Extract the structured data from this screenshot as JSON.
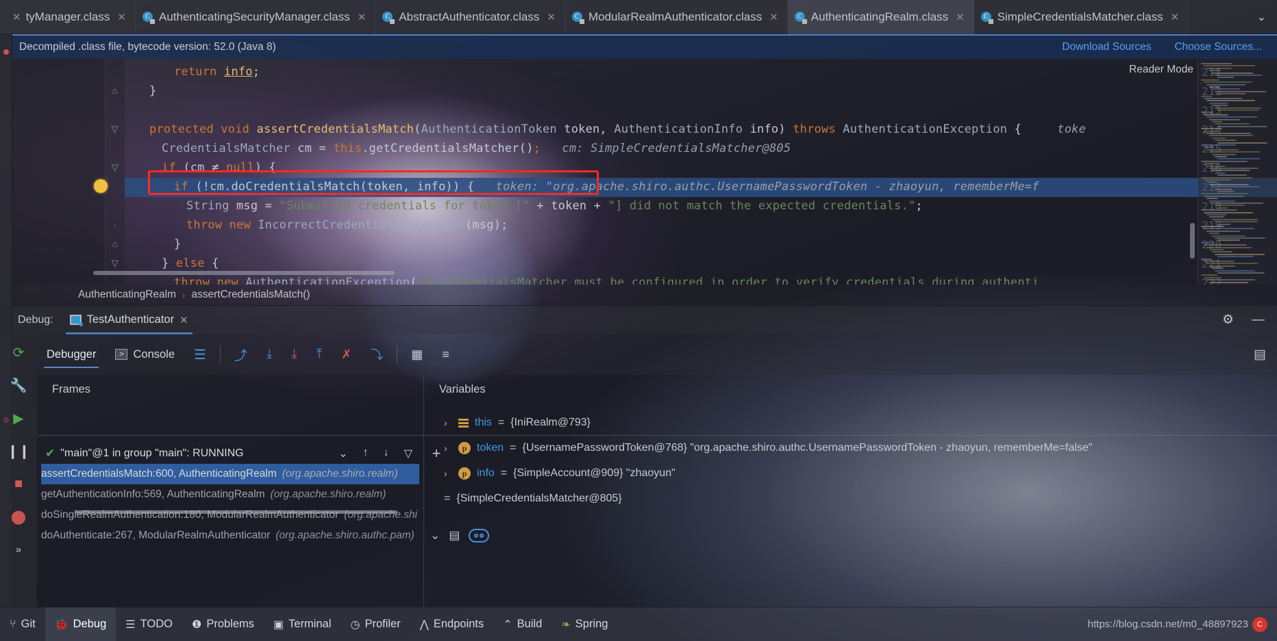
{
  "tabs": [
    {
      "label": "tyManager.class",
      "icon": "class-file-icon",
      "active": false,
      "truncated": true
    },
    {
      "label": "AuthenticatingSecurityManager.class",
      "icon": "class-file-icon",
      "active": false
    },
    {
      "label": "AbstractAuthenticator.class",
      "icon": "class-file-icon",
      "active": false
    },
    {
      "label": "ModularRealmAuthenticator.class",
      "icon": "class-file-icon",
      "active": false
    },
    {
      "label": "AuthenticatingRealm.class",
      "icon": "class-file-icon",
      "active": true
    },
    {
      "label": "SimpleCredentialsMatcher.class",
      "icon": "class-file-icon",
      "active": false
    }
  ],
  "tab_overflow_icon": "chevron-down-icon",
  "notification": {
    "message": "Decompiled .class file, bytecode version: 52.0 (Java 8)",
    "download_sources": "Download Sources",
    "choose_sources": "Choose Sources..."
  },
  "editor": {
    "reader_mode": "Reader Mode",
    "highlighted_line": 217,
    "lines": [
      {
        "num": 211,
        "indent": 4,
        "fold": "",
        "tokens": [
          {
            "t": "return ",
            "c": "kw"
          },
          {
            "t": "info",
            "c": "fld u"
          },
          {
            "t": ";",
            "c": "plain"
          }
        ]
      },
      {
        "num": 212,
        "indent": 2,
        "fold": "end",
        "tokens": [
          {
            "t": "}",
            "c": "plain"
          }
        ]
      },
      {
        "num": 213,
        "indent": 0,
        "fold": "",
        "tokens": []
      },
      {
        "num": 214,
        "indent": 2,
        "fold": "open",
        "tokens": [
          {
            "t": "protected ",
            "c": "kw"
          },
          {
            "t": "void ",
            "c": "kw"
          },
          {
            "t": "assertCredentialsMatch",
            "c": "kw2"
          },
          {
            "t": "(",
            "c": "plain"
          },
          {
            "t": "AuthenticationToken",
            "c": "typ"
          },
          {
            "t": " token, ",
            "c": "plain"
          },
          {
            "t": "AuthenticationInfo",
            "c": "typ"
          },
          {
            "t": " info) ",
            "c": "plain"
          },
          {
            "t": "throws ",
            "c": "kw"
          },
          {
            "t": "AuthenticationException",
            "c": "typ"
          },
          {
            "t": " {",
            "c": "plain"
          },
          {
            "t": "     toke",
            "c": "hint"
          }
        ]
      },
      {
        "num": 215,
        "indent": 3,
        "fold": "",
        "tokens": [
          {
            "t": "CredentialsMatcher",
            "c": "typ"
          },
          {
            "t": " cm = ",
            "c": "plain"
          },
          {
            "t": "this",
            "c": "kw"
          },
          {
            "t": ".getCredentialsMatcher",
            "c": "plain"
          },
          {
            "t": "()",
            "c": "plain"
          },
          {
            "t": ";",
            "c": "kw"
          },
          {
            "t": "   cm: SimpleCredentialsMatcher@805",
            "c": "hint"
          }
        ]
      },
      {
        "num": 216,
        "indent": 3,
        "fold": "open",
        "tokens": [
          {
            "t": "if ",
            "c": "kw"
          },
          {
            "t": "(cm ",
            "c": "plain"
          },
          {
            "t": "≠",
            "c": "plain"
          },
          {
            "t": " ",
            "c": "plain"
          },
          {
            "t": "null",
            "c": "kw"
          },
          {
            "t": ") {",
            "c": "plain"
          }
        ]
      },
      {
        "num": 217,
        "indent": 4,
        "fold": "",
        "highlight": true,
        "tokens": [
          {
            "t": "if ",
            "c": "kw"
          },
          {
            "t": "(!cm.doCredentialsMatch(token, info)) {",
            "c": "plain"
          },
          {
            "t": "   token: \"org.apache.shiro.authc.UsernamePasswordToken - zhaoyun, rememberMe=f",
            "c": "hint"
          }
        ]
      },
      {
        "num": 218,
        "indent": 5,
        "fold": "",
        "tokens": [
          {
            "t": "String",
            "c": "typ"
          },
          {
            "t": " msg = ",
            "c": "plain"
          },
          {
            "t": "\"Submitted credentials for token [\"",
            "c": "str"
          },
          {
            "t": " + token + ",
            "c": "plain"
          },
          {
            "t": "\"] did not match the expected credentials.\"",
            "c": "str"
          },
          {
            "t": ";",
            "c": "plain"
          }
        ]
      },
      {
        "num": 219,
        "indent": 5,
        "fold": "dot",
        "tokens": [
          {
            "t": "throw ",
            "c": "kw"
          },
          {
            "t": "new ",
            "c": "kw"
          },
          {
            "t": "IncorrectCredentialsException",
            "c": "typ"
          },
          {
            "t": "(msg);",
            "c": "plain"
          }
        ]
      },
      {
        "num": 220,
        "indent": 4,
        "fold": "end",
        "tokens": [
          {
            "t": "}",
            "c": "plain"
          }
        ]
      },
      {
        "num": 221,
        "indent": 3,
        "fold": "open",
        "tokens": [
          {
            "t": "} ",
            "c": "plain"
          },
          {
            "t": "else ",
            "c": "kw"
          },
          {
            "t": "{",
            "c": "plain"
          }
        ]
      },
      {
        "num": 222,
        "indent": 4,
        "fold": "",
        "tokens": [
          {
            "t": "throw ",
            "c": "kw"
          },
          {
            "t": "new ",
            "c": "kw"
          },
          {
            "t": "AuthenticationException",
            "c": "typ"
          },
          {
            "t": "(",
            "c": "plain"
          },
          {
            "t": "\"A CredentialsMatcher must be configured in order to verify credentials during authenti",
            "c": "str"
          }
        ]
      }
    ]
  },
  "breadcrumb": {
    "items": [
      "AuthenticatingRealm",
      "assertCredentialsMatch()"
    ],
    "separator": "›"
  },
  "debug_header": {
    "label": "Debug:",
    "session_tab": "TestAuthenticator",
    "session_close_icon": "close-icon",
    "settings_icon": "gear-icon",
    "minimize_icon": "minimize-icon"
  },
  "debug_toolbar": {
    "tabs": [
      {
        "label": "Debugger",
        "selected": true,
        "icon": ""
      },
      {
        "label": "Console",
        "selected": false,
        "icon": "console-icon"
      }
    ],
    "icons": [
      "layout-lines-icon",
      "step-over-icon",
      "step-into-icon",
      "force-step-into-icon",
      "step-out-icon",
      "drop-frame-icon",
      "run-to-cursor-icon",
      "evaluate-expression-icon",
      "settings-lines-icon"
    ],
    "right_icon": "restore-layout-icon"
  },
  "left_rail_icons": [
    "rerun-icon",
    "wrench-icon",
    "resume-icon",
    "pause-icon",
    "stop-icon",
    "mute-breakpoints-icon",
    "more-icon"
  ],
  "frames": {
    "title": "Frames",
    "thread": "\"main\"@1 in group \"main\": RUNNING",
    "thread_controls": [
      "chevron-down-icon",
      "arrow-up-icon",
      "arrow-down-icon",
      "filter-icon"
    ],
    "rows": [
      {
        "name": "assertCredentialsMatch:600, AuthenticatingRealm",
        "pkg": "(org.apache.shiro.realm)",
        "selected": true
      },
      {
        "name": "getAuthenticationInfo:569, AuthenticatingRealm",
        "pkg": "(org.apache.shiro.realm)",
        "selected": false
      },
      {
        "name": "doSingleRealmAuthentication:180, ModularRealmAuthenticator",
        "pkg": "(org.apache.shi",
        "selected": false
      },
      {
        "name": "doAuthenticate:267, ModularRealmAuthenticator",
        "pkg": "(org.apache.shiro.authc.pam)",
        "selected": false
      }
    ]
  },
  "variables": {
    "title": "Variables",
    "add_icon": "plus-icon",
    "rows": [
      {
        "expander": "›",
        "badge": "this",
        "name": "this",
        "eq": "=",
        "value": "{IniRealm@793}"
      },
      {
        "expander": "›",
        "badge": "p",
        "name": "token",
        "eq": "=",
        "value": "{UsernamePasswordToken@768} \"org.apache.shiro.authc.UsernamePasswordToken - zhaoyun, rememberMe=false\""
      },
      {
        "expander": "›",
        "badge": "p",
        "name": "info",
        "eq": "=",
        "value": "{SimpleAccount@909} \"zhaoyun\""
      },
      {
        "expander": "",
        "badge": "",
        "name": "",
        "eq": "=",
        "value": "{SimpleCredentialsMatcher@805}"
      }
    ],
    "bottom_icons": [
      "chevron-down-icon",
      "copy-icon",
      "watches-toggle-icon"
    ]
  },
  "statusbar": {
    "items": [
      {
        "label": "Git",
        "icon": "git-icon",
        "active": false
      },
      {
        "label": "Debug",
        "icon": "debug-bug-icon",
        "active": true
      },
      {
        "label": "TODO",
        "icon": "todo-list-icon",
        "active": false
      },
      {
        "label": "Problems",
        "icon": "problems-icon",
        "active": false
      },
      {
        "label": "Terminal",
        "icon": "terminal-icon",
        "active": false
      },
      {
        "label": "Profiler",
        "icon": "profiler-icon",
        "active": false
      },
      {
        "label": "Endpoints",
        "icon": "endpoints-icon",
        "active": false
      },
      {
        "label": "Build",
        "icon": "build-hammer-icon",
        "active": false
      },
      {
        "label": "Spring",
        "icon": "spring-leaf-icon",
        "active": false
      }
    ],
    "watermark": "https://blog.csdn.net/m0_48897923",
    "watermark_badge": "C"
  },
  "colors": {
    "accent_blue": "#4a88c7",
    "link_blue": "#589df6",
    "highlight_row": "#2b4d81",
    "red_box": "#ff2a20",
    "selection_blue": "#2f5d9e",
    "keyword_orange": "#cc7832",
    "string_green": "#6a8759"
  }
}
